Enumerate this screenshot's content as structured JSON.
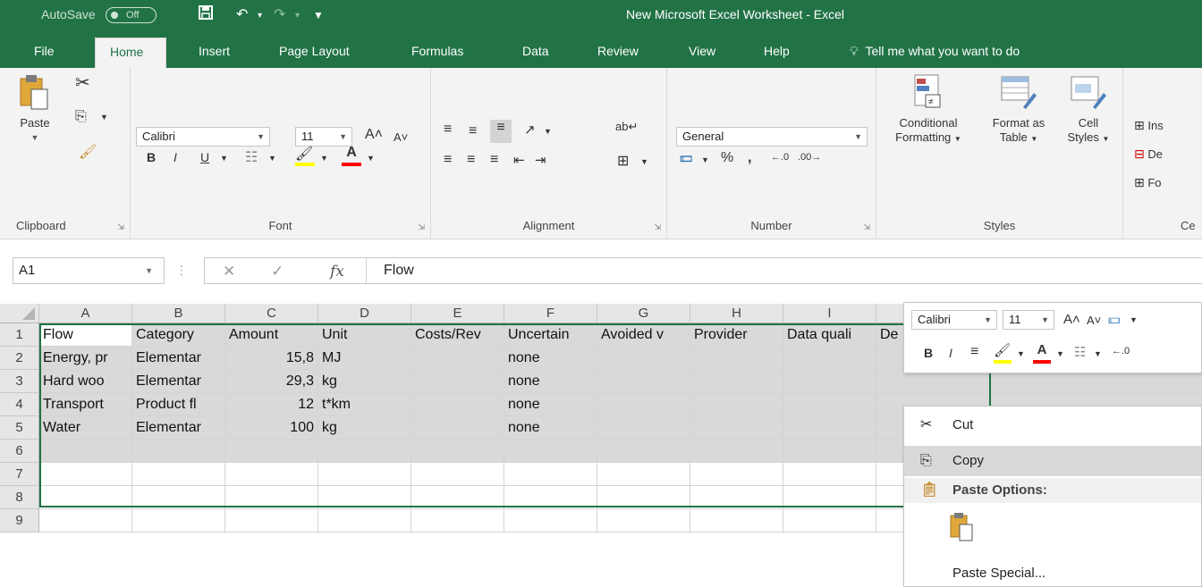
{
  "titlebar": {
    "autosave_label": "AutoSave",
    "autosave_state": "Off",
    "window_title": "New Microsoft Excel Worksheet  -  Excel"
  },
  "tabs": [
    "File",
    "Home",
    "Insert",
    "Page Layout",
    "Formulas",
    "Data",
    "Review",
    "View",
    "Help"
  ],
  "active_tab": "Home",
  "tell_me": "Tell me what you want to do",
  "ribbon": {
    "clipboard": {
      "paste": "Paste",
      "label": "Clipboard"
    },
    "font": {
      "name": "Calibri",
      "size": "11",
      "bold": "B",
      "italic": "I",
      "underline": "U",
      "label": "Font"
    },
    "alignment": {
      "label": "Alignment"
    },
    "number": {
      "format": "General",
      "percent": "%",
      "comma": ",",
      "label": "Number"
    },
    "styles": {
      "conditional_line1": "Conditional",
      "conditional_line2": "Formatting",
      "format_table_line1": "Format as",
      "format_table_line2": "Table",
      "cell_styles_line1": "Cell",
      "cell_styles_line2": "Styles",
      "label": "Styles"
    },
    "cells": {
      "insert": "Ins",
      "delete": "De",
      "format": "Fo",
      "label": "Ce"
    }
  },
  "formula_bar": {
    "name_box": "A1",
    "content": "Flow"
  },
  "columns": [
    "A",
    "B",
    "C",
    "D",
    "E",
    "F",
    "G",
    "H",
    "I"
  ],
  "rows": [
    "1",
    "2",
    "3",
    "4",
    "5",
    "6",
    "7",
    "8",
    "9"
  ],
  "cells": [
    [
      "Flow",
      "Category",
      "Amount",
      "Unit",
      "Costs/Rev",
      "Uncertain",
      "Avoided v",
      "Provider",
      "Data quali",
      "De"
    ],
    [
      "Energy, pr",
      "Elementar",
      "15,8",
      "MJ",
      "",
      "none",
      "",
      "",
      "",
      ""
    ],
    [
      "Hard woo",
      "Elementar",
      "29,3",
      "kg",
      "",
      "none",
      "",
      "",
      "",
      ""
    ],
    [
      "Transport",
      "Product fl",
      "12",
      "t*km",
      "",
      "none",
      "",
      "",
      "",
      ""
    ],
    [
      "Water",
      "Elementar",
      "100",
      "kg",
      "",
      "none",
      "",
      "",
      "",
      ""
    ],
    [
      "",
      "",
      "",
      "",
      "",
      "",
      "",
      "",
      "",
      ""
    ]
  ],
  "mini_toolbar": {
    "font": "Calibri",
    "size": "11",
    "bold": "B",
    "italic": "I"
  },
  "context_menu": {
    "cut": "Cut",
    "copy": "Copy",
    "paste_options": "Paste Options:",
    "paste_special": "Paste Special..."
  },
  "colors": {
    "excel_green": "#217346",
    "ribbon_bg": "#f3f3f3",
    "selection_gray": "#d9d9d9"
  }
}
